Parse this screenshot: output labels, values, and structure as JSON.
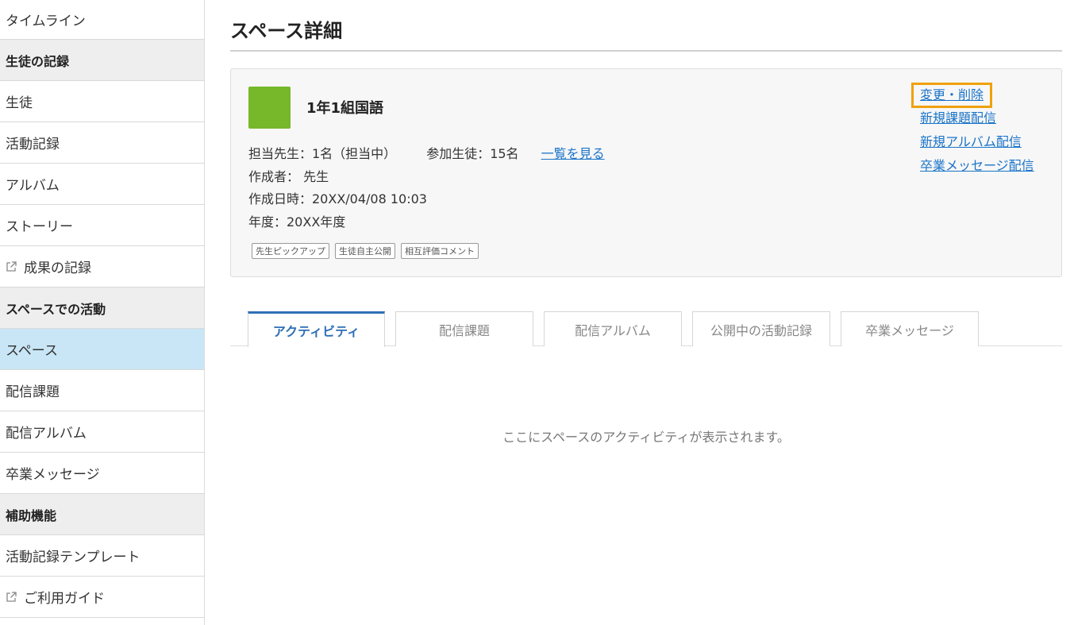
{
  "sidebar": {
    "items": [
      {
        "label": "タイムライン"
      },
      {
        "label": "生徒の記録"
      },
      {
        "label": "生徒"
      },
      {
        "label": "活動記録"
      },
      {
        "label": "アルバム"
      },
      {
        "label": "ストーリー"
      },
      {
        "label": "成果の記録",
        "icon": "external-link-icon"
      },
      {
        "label": "スペースでの活動"
      },
      {
        "label": "スペース"
      },
      {
        "label": "配信課題"
      },
      {
        "label": "配信アルバム"
      },
      {
        "label": "卒業メッセージ"
      },
      {
        "label": "補助機能"
      },
      {
        "label": "活動記録テンプレート"
      },
      {
        "label": "ご利用ガイド",
        "icon": "external-link-icon"
      }
    ],
    "active_item": "スペース"
  },
  "page": {
    "title": "スペース詳細"
  },
  "space": {
    "name": "1年1組国語",
    "color": "#76b82a",
    "teachers": "担当先生：1名（担当中）",
    "students": "参加生徒：15名",
    "view_list_link": "一覧を見る",
    "creator": "作成者： 先生",
    "created_at": "作成日時：20XX/04/08 10:03",
    "year": "年度：20XX年度",
    "tags": [
      "先生ピックアップ",
      "生徒自主公開",
      "相互評価コメント"
    ]
  },
  "actions": {
    "edit_delete": "変更・削除",
    "new_assignment": "新規課題配信",
    "new_album": "新規アルバム配信",
    "graduation_message": "卒業メッセージ配信"
  },
  "tabs": [
    {
      "label": "アクティビティ",
      "active": true
    },
    {
      "label": "配信課題",
      "active": false
    },
    {
      "label": "配信アルバム",
      "active": false
    },
    {
      "label": "公開中の活動記録",
      "active": false
    },
    {
      "label": "卒業メッセージ",
      "active": false
    }
  ],
  "activity": {
    "empty_message": "ここにスペースのアクティビティが表示されます。"
  },
  "colors": {
    "accent": "#2f6fb5",
    "link": "#1a73c8",
    "highlight": "#f0a10a",
    "active_sidebar": "#c8e6f5"
  }
}
